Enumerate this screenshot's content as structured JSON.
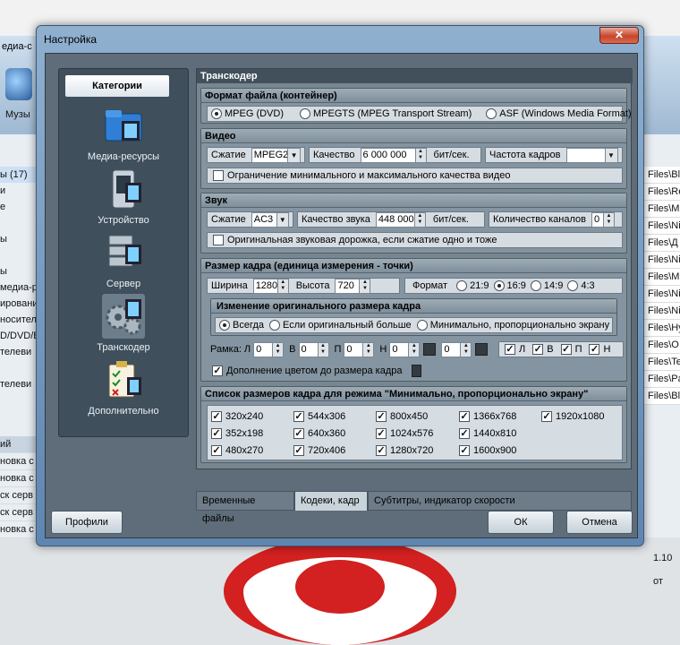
{
  "background": {
    "app_title": "едиа-с",
    "toolbar_label": "Музы",
    "left_list": [
      "ы (17)",
      "и",
      "е",
      "",
      "ы",
      "",
      "ы",
      "медиа-р",
      "ирования",
      "носител",
      "D/DVD/B",
      "телеви",
      "",
      "телеви"
    ],
    "left_bottom": [
      "ий",
      "новка с",
      "новка с",
      "ск серв",
      "ск серв",
      "новка с"
    ],
    "right_list": [
      "Files\\Bl",
      "Files\\Re",
      "Files\\M",
      "Files\\Ni",
      "Files\\Д",
      "Files\\Ni",
      "Files\\M",
      "Files\\Ni",
      "Files\\Ni",
      "Files\\Hy",
      "Files\\O",
      "Files\\Te",
      "Files\\Pa",
      "Files\\Bl"
    ],
    "right_status": "1.10 от"
  },
  "dialog": {
    "title": "Настройка",
    "close_glyph": "✕"
  },
  "categories": {
    "header": "Категории",
    "items": [
      "Медиа-ресурсы",
      "Устройство",
      "Сервер",
      "Транскодер",
      "Дополнительно"
    ],
    "selected": "Транскодер"
  },
  "transcoder": {
    "section_title": "Транскодер",
    "container": {
      "header": "Формат файла (контейнер)",
      "options": [
        "MPEG (DVD)",
        "MPEGTS (MPEG Transport Stream)",
        "ASF (Windows Media Format)"
      ],
      "selected": "MPEG (DVD)"
    },
    "video": {
      "header": "Видео",
      "compression_label": "Сжатие",
      "compression_value": "MPEG2",
      "quality_label": "Качество",
      "quality_value": "6 000 000",
      "quality_unit": "бит/сек.",
      "framerate_label": "Частота кадров",
      "framerate_value": "",
      "limit_label": "Ограничение минимального и максимального качества видео",
      "limit_checked": false
    },
    "audio": {
      "header": "Звук",
      "compression_label": "Сжатие",
      "compression_value": "AC3",
      "quality_label": "Качество звука",
      "quality_value": "448 000",
      "quality_unit": "бит/сек.",
      "channels_label": "Количество каналов",
      "channels_value": "0",
      "original_label": "Оригинальная звуковая дорожка, если сжатие одно и тоже",
      "original_checked": false
    },
    "frame": {
      "header": "Размер кадра (единица измерения - точки)",
      "width_label": "Ширина",
      "width_value": "1280",
      "height_label": "Высота",
      "height_value": "720",
      "format_label": "Формат",
      "formats": [
        "21:9",
        "16:9",
        "14:9",
        "4:3"
      ],
      "format_selected": "16:9",
      "resize": {
        "header": "Изменение оригинального размера кадра",
        "options": [
          "Всегда",
          "Если оригинальный больше",
          "Минимально, пропорционально экрану"
        ],
        "selected": "Всегда"
      },
      "border_label": "Рамка: Л",
      "border_fields": [
        {
          "label": "",
          "value": "0"
        },
        {
          "label": "В",
          "value": "0"
        },
        {
          "label": "П",
          "value": "0"
        },
        {
          "label": "Н",
          "value": "0"
        },
        {
          "label": "",
          "value": "0"
        }
      ],
      "border_checks": [
        "Л",
        "В",
        "П",
        "Н"
      ],
      "fill_label": "Дополнение цветом до размера кадра",
      "fill_checked": true
    },
    "sizes": {
      "header": "Список размеров кадра для режима \"Минимально, пропорционально экрану\"",
      "columns": [
        [
          "320x240",
          "352x198",
          "480x270"
        ],
        [
          "544x306",
          "640x360",
          "720x406"
        ],
        [
          "800x450",
          "1024x576",
          "1280x720"
        ],
        [
          "1366x768",
          "1440x810",
          "1600x900"
        ],
        [
          "1920x1080"
        ]
      ]
    }
  },
  "tabs": [
    "Временные файлы",
    "Кодеки, кадр",
    "Субтитры, индикатор скорости"
  ],
  "active_tab": "Кодеки, кадр",
  "buttons": {
    "profiles": "Профили",
    "ok": "ОК",
    "cancel": "Отмена"
  }
}
